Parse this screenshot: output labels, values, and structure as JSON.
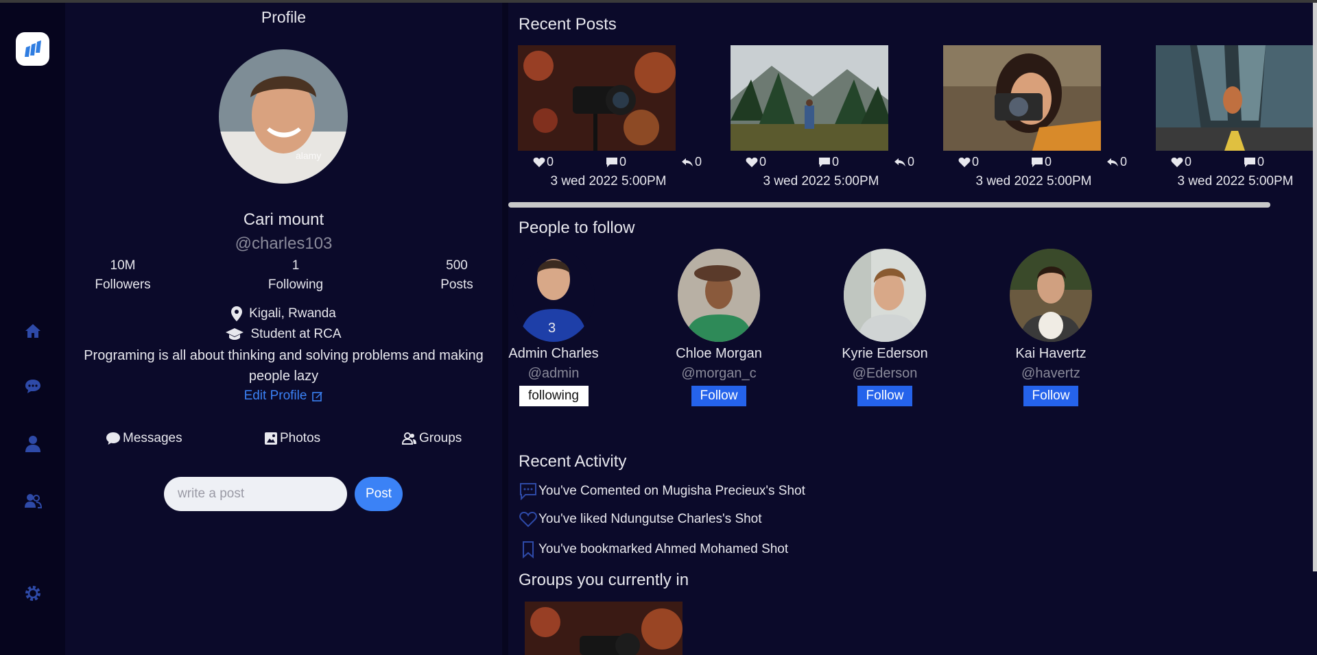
{
  "profile": {
    "title": "Profile",
    "name": "Cari mount",
    "handle": "@charles103",
    "stats": [
      {
        "value": "10M",
        "label": "Followers"
      },
      {
        "value": "1",
        "label": "Following"
      },
      {
        "value": "500",
        "label": "Posts"
      }
    ],
    "location": "Kigali, Rwanda",
    "education": "Student at RCA",
    "bio": "Programing is all about thinking and solving problems and making people lazy",
    "edit_label": "Edit Profile",
    "tabs": {
      "messages": "Messages",
      "photos": "Photos",
      "groups": "Groups"
    },
    "post_placeholder": "write a post",
    "post_button": "Post"
  },
  "recent_posts": {
    "title": "Recent Posts",
    "items": [
      {
        "likes": "0",
        "comments": "0",
        "shares": "0",
        "date": "3 wed 2022 5:00PM",
        "image": "camera-bokeh"
      },
      {
        "likes": "0",
        "comments": "0",
        "shares": "0",
        "date": "3 wed 2022 5:00PM",
        "image": "mountain-forest"
      },
      {
        "likes": "0",
        "comments": "0",
        "shares": "0",
        "date": "3 wed 2022 5:00PM",
        "image": "woman-camera"
      },
      {
        "likes": "0",
        "comments": "0",
        "shares": "",
        "date": "3 wed 2022 5:00PM",
        "image": "city-skater"
      }
    ]
  },
  "people": {
    "title": "People to follow",
    "items": [
      {
        "name": "Admin Charles",
        "handle": "@admin",
        "button": "following"
      },
      {
        "name": "Chloe Morgan",
        "handle": "@morgan_c",
        "button": "Follow"
      },
      {
        "name": "Kyrie Ederson",
        "handle": "@Ederson",
        "button": "Follow"
      },
      {
        "name": "Kai Havertz",
        "handle": "@havertz",
        "button": "Follow"
      }
    ]
  },
  "activity": {
    "title": "Recent Activity",
    "items": [
      {
        "icon": "comment-icon",
        "text": "You've Comented on Mugisha Precieux's Shot"
      },
      {
        "icon": "heart-icon",
        "text": "You've liked Ndungutse Charles's Shot"
      },
      {
        "icon": "bookmark-icon",
        "text": "You've bookmarked Ahmed Mohamed Shot"
      }
    ]
  },
  "groups": {
    "title": "Groups you currently in"
  },
  "colors": {
    "background": "#0b0a2a",
    "sidebar": "#06051e",
    "accent": "#3b82f6",
    "nav_icon": "#2e4aa8"
  }
}
